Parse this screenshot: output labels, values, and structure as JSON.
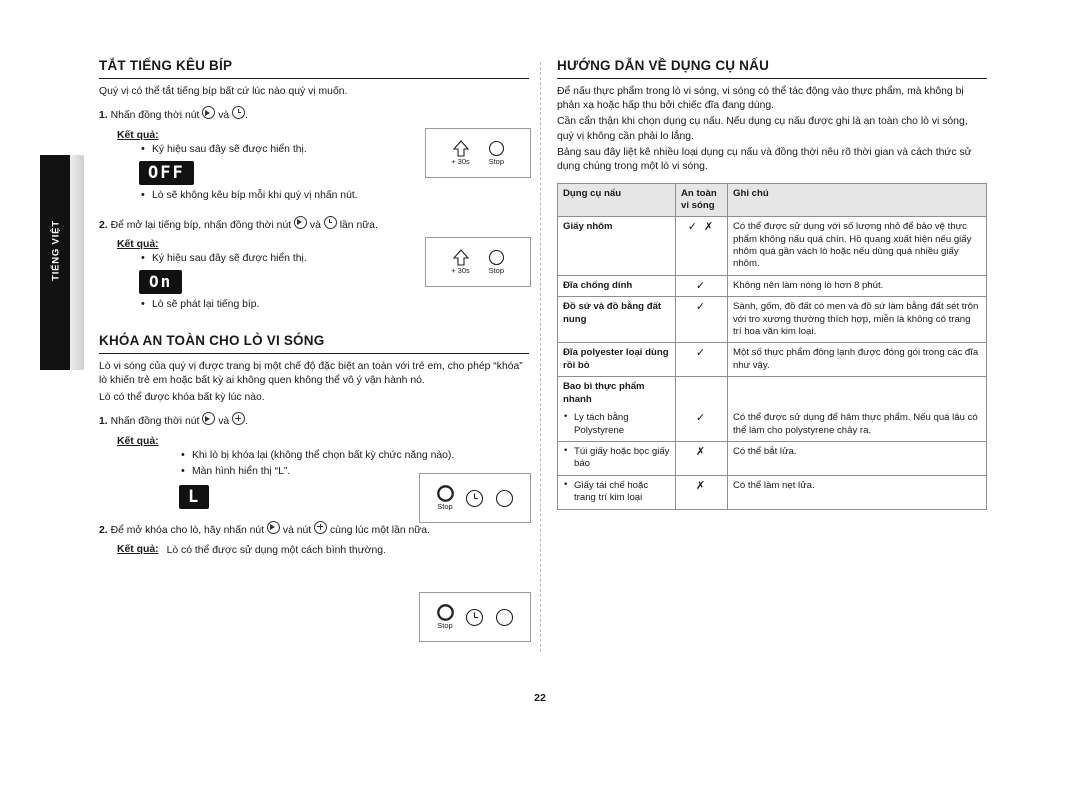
{
  "sidebar": {
    "tab_label": "TIẾNG VIỆT"
  },
  "left": {
    "section1": {
      "title": "TẮT TIẾNG KÊU BÍP",
      "intro": "Quý vị có thể tắt tiếng bíp bất cứ lúc nào quý vị muốn.",
      "step1": "Nhấn đồng thời nút",
      "step1_num": "1.",
      "step1_mid": "và",
      "step1_end": ".",
      "result_label": "Kết quả:",
      "bullets1": [
        "Ký hiệu sau đây sẽ được hiển thị.",
        "Lò sẽ không kêu bíp mỗi khi quý vị nhấn nút."
      ],
      "lcd1": "OFF",
      "step2_num": "2.",
      "step2": "Để mở lại tiếng bíp, nhấn đồng thời nút",
      "step2_mid": "và",
      "step2_end": "lần nữa.",
      "bullets2": [
        "Ký hiệu sau đây sẽ được hiển thị.",
        "Lò sẽ phát lại tiếng bíp."
      ],
      "lcd2": "On"
    },
    "section2": {
      "title": "KHÓA AN TOÀN CHO LÒ VI SÓNG",
      "para1": "Lò vi sóng của quý vị được trang bị một chế độ đặc biệt an toàn với trẻ em, cho phép “khóa” lò khiến trẻ em hoặc bất kỳ ai không quen không thể vô ý vận hành nó.",
      "para2": "Lò có thể được khóa bất kỳ lúc nào.",
      "step1_num": "1.",
      "step1": "Nhấn đồng thời nút",
      "step1_mid": "và",
      "step1_end": ".",
      "result_label": "Kết quả:",
      "bullets1": [
        "Khi lò bị khóa lại (không thể chọn bất kỳ chức năng nào).",
        "Màn hình hiển thị “L”."
      ],
      "lcd1": "L",
      "step2_num": "2.",
      "step2": "Để mở khóa cho lò, hãy nhấn nút",
      "step2_mid": "và nút",
      "step2_end": "cùng lúc một lần nữa.",
      "result2_label": "Kết quả:",
      "result2_text": "Lò có thể được sử dụng một cách bình thường."
    },
    "keys": {
      "plus30s": "+ 30s",
      "stop": "Stop"
    }
  },
  "right": {
    "title": "HƯỚNG DẪN VỀ DỤNG CỤ NẤU",
    "paragraphs": [
      "Để nấu thực phẩm trong lò vi sóng, vi sóng có thể tác động vào thực phẩm, mà không bị phản xạ hoặc hấp thu bởi chiếc đĩa đang dùng.",
      "Cần cẩn thận khi chọn dụng cụ nấu. Nếu dụng cụ nấu được ghi là an toàn cho lò vi sóng, quý vị không cần phải lo lắng.",
      "Bảng sau đây liệt kê nhiều loại dụng cụ nấu và đồng thời nêu rõ thời gian và cách thức sử dụng chúng trong một lò vi sóng."
    ],
    "table": {
      "headers": [
        "Dụng cụ nấu",
        "An toàn vi sóng",
        "Ghi chú"
      ],
      "rows": [
        {
          "name": "Giấy nhôm",
          "mark": "✓ ✗",
          "note": "Có thể được sử dụng với số lượng nhỏ để bảo vệ thực phẩm không nấu quá chín. Hồ quang xuất hiện nếu giấy nhôm quá gần vách lò hoặc nếu dùng quá nhiều giấy nhôm."
        },
        {
          "name": "Đĩa chống dính",
          "mark": "✓",
          "note": "Không nên làm nóng lò hơn 8 phút."
        },
        {
          "name": "Đồ sứ và đồ bằng đất nung",
          "mark": "✓",
          "note": "Sành, gốm, đồ đất có men và đồ sứ làm bằng đất sét trộn với tro xương thường thích hợp, miễn là không có trang trí hoa văn kim loại."
        },
        {
          "name": "Đĩa polyester loại dùng rồi bỏ",
          "mark": "✓",
          "note": "Một số thực phẩm đông lạnh được đóng gói trong các đĩa như vậy."
        }
      ],
      "group": {
        "name": "Bao bì thực phẩm nhanh",
        "items": [
          {
            "label": "Ly tách bằng Polystyrene",
            "mark": "✓",
            "note": "Có thể được sử dụng để hâm thực phẩm. Nếu quá lâu có thể làm cho polystyrene chảy ra."
          },
          {
            "label": "Túi giấy hoặc bọc giấy báo",
            "mark": "✗",
            "note": "Có thể bắt lửa."
          },
          {
            "label": "Giấy tái chế hoặc trang trí kim loại",
            "mark": "✗",
            "note": "Có thể làm nẹt lửa."
          }
        ]
      }
    }
  },
  "footer": {
    "page_number": "22"
  }
}
